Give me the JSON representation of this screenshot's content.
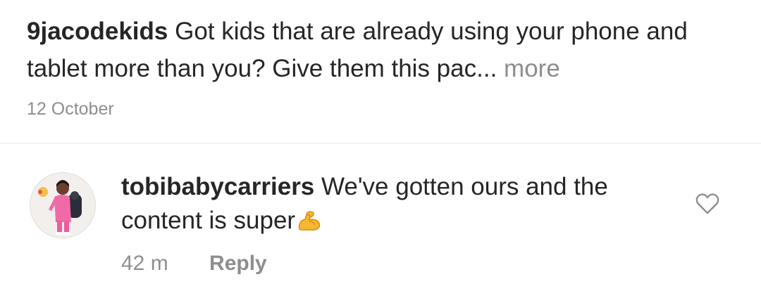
{
  "caption": {
    "username": "9jacodekids",
    "text": " Got kids that are already using your phone and tablet more than you? Give them this pac",
    "ellipsis": "...",
    "more_label": " more",
    "date": "12 October"
  },
  "comment": {
    "username": "tobibabycarriers",
    "text": " We've gotten ours and the content is super",
    "emoji": "flexed-biceps-emoji",
    "time": "42 m",
    "reply_label": "Reply",
    "like_icon": "heart-outline-icon"
  },
  "colors": {
    "primary_text": "#262626",
    "secondary_text": "#8e8e8e",
    "divider": "#e6e6e6"
  }
}
